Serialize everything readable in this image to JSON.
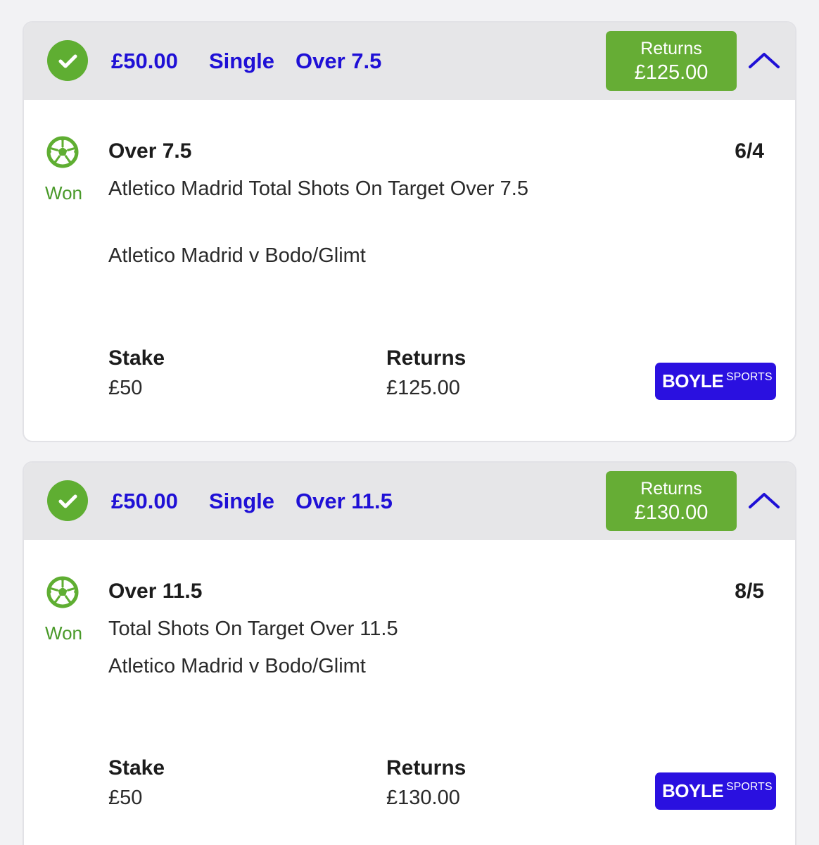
{
  "brand": {
    "green": "#5fae32",
    "blue": "#1f10d6",
    "logo_bg": "#2a10e0"
  },
  "bets": [
    {
      "header": {
        "stake": "£50.00",
        "bet_type": "Single",
        "market": "Over 7.5",
        "returns_label": "Returns",
        "returns_value": "£125.00",
        "status_icon": "check-circle-icon",
        "collapse_icon": "chevron-up-icon"
      },
      "selection": {
        "sport_icon": "football-icon",
        "result": "Won",
        "title": "Over 7.5",
        "odds": "6/4",
        "description": "Atletico Madrid Total Shots On Target Over 7.5",
        "event": "Atletico Madrid v Bodo/Glimt"
      },
      "footer": {
        "stake_label": "Stake",
        "stake_value": "£50",
        "returns_label": "Returns",
        "returns_value": "£125.00",
        "logo_word1": "BOYLE",
        "logo_word2": "SPORTS"
      }
    },
    {
      "header": {
        "stake": "£50.00",
        "bet_type": "Single",
        "market": "Over 11.5",
        "returns_label": "Returns",
        "returns_value": "£130.00",
        "status_icon": "check-circle-icon",
        "collapse_icon": "chevron-up-icon"
      },
      "selection": {
        "sport_icon": "football-icon",
        "result": "Won",
        "title": "Over 11.5",
        "odds": "8/5",
        "description": "Total Shots On Target Over 11.5",
        "event": "Atletico Madrid v Bodo/Glimt"
      },
      "footer": {
        "stake_label": "Stake",
        "stake_value": "£50",
        "returns_label": "Returns",
        "returns_value": "£130.00",
        "logo_word1": "BOYLE",
        "logo_word2": "SPORTS"
      }
    }
  ]
}
